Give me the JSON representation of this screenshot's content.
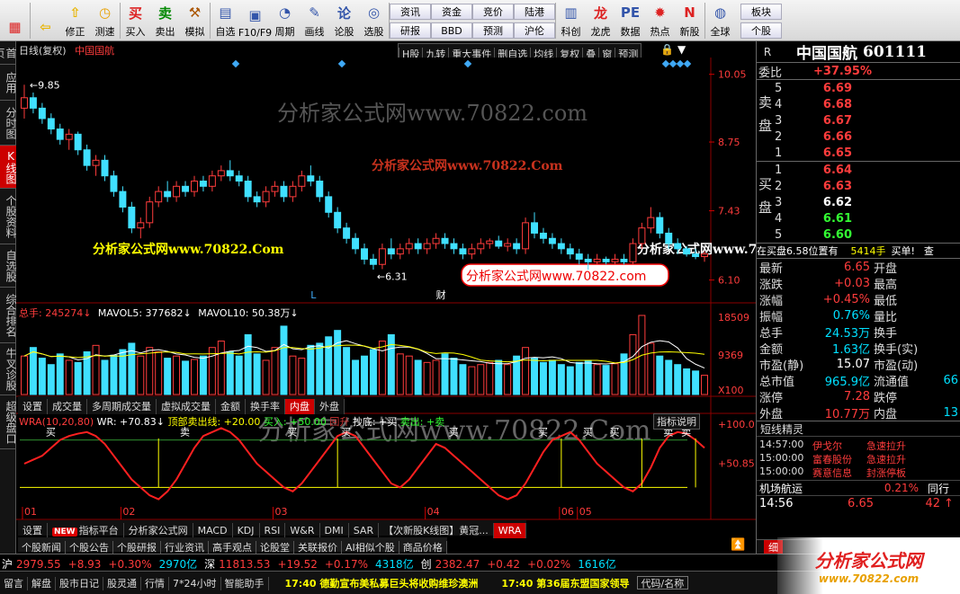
{
  "toolbar": {
    "buttons": [
      {
        "label": "",
        "icon": "windows-icon",
        "color": "#d22"
      },
      {
        "label": "",
        "icon": "back-arrow-icon",
        "color": "#e8b400"
      },
      {
        "label": "修正",
        "icon": "up-arrow-icon",
        "color": "#e8b400"
      },
      {
        "label": "测速",
        "icon": "clock-icon",
        "color": "#e8a000"
      },
      {
        "label": "买入",
        "icon": "buy-icon",
        "color": "#d22"
      },
      {
        "label": "卖出",
        "icon": "sell-icon",
        "color": "#080"
      },
      {
        "label": "模拟",
        "icon": "hammer-icon",
        "color": "#a50"
      },
      {
        "label": "自选",
        "icon": "watchlist-icon",
        "color": "#35a"
      },
      {
        "label": "F10/F9",
        "icon": "f10-icon",
        "color": "#35a"
      },
      {
        "label": "周期",
        "icon": "period-icon",
        "color": "#35a"
      },
      {
        "label": "画线",
        "icon": "pencil-icon",
        "color": "#35a"
      },
      {
        "label": "论股",
        "icon": "discuss-icon",
        "color": "#35a"
      },
      {
        "label": "选股",
        "icon": "chart-pick-icon",
        "color": "#35a"
      }
    ],
    "pairs": [
      [
        "资讯",
        "研报"
      ],
      [
        "资金",
        "BBD"
      ],
      [
        "竞价",
        "预测"
      ],
      [
        "陆港",
        "沪伦"
      ]
    ],
    "buttons2": [
      {
        "label": "科创",
        "icon": "science-icon",
        "color": "#35a"
      },
      {
        "label": "龙虎",
        "icon": "dragon-icon",
        "color": "#d22"
      },
      {
        "label": "数据",
        "icon": "pe-icon",
        "color": "#35a"
      },
      {
        "label": "热点",
        "icon": "hot-icon",
        "color": "#d22"
      },
      {
        "label": "新股",
        "icon": "new-stock-icon",
        "color": "#d22"
      },
      {
        "label": "全球",
        "icon": "globe-icon",
        "color": "#35a"
      }
    ],
    "pair_right": [
      "板块",
      "个股"
    ]
  },
  "sidebar": [
    "首页",
    "应用",
    "分时图",
    "K线图",
    "个股资料",
    "自选股",
    "综合排名",
    "牛叉诊股",
    "超级盘口"
  ],
  "chart": {
    "title_left": "日线(复权)",
    "stock_name": "中国国航",
    "buttons": [
      "H股",
      "九转",
      "重大事件",
      "删自选",
      "均线",
      "复权",
      "叠",
      "窗",
      "预测"
    ],
    "price_ticks": [
      "10.05",
      "8.75",
      "7.43",
      "6.10"
    ],
    "high_label": "9.85",
    "low_label": "6.31",
    "marker_L": "L",
    "marker_cai": "财",
    "vol_header": {
      "total": "总手: 245274↓",
      "ma5": "MAVOL5: 377682↓",
      "ma10": "MAVOL10: 50.38万↓"
    },
    "vol_ticks": [
      "18509",
      "9369",
      "X100"
    ],
    "vol_tabs": [
      "设置",
      "成交量",
      "多周期成交量",
      "虚拟成交量",
      "金额",
      "换手率",
      "内盘",
      "外盘"
    ],
    "vol_tab_active": "内盘",
    "wra_header": {
      "name": "WRA(10,20,80)",
      "wr": "WR: +70.83↓",
      "top": "顶部卖出线: +20.00",
      "mid": "买入: +50.00",
      "extra": "回升",
      "buy_sig": "抄底: +买",
      "sell_sig": "卖出: +卖"
    },
    "wra_btn": "指标说明",
    "wra_ticks": [
      "+100.0",
      "+50.85"
    ],
    "wra_signals": [
      "买",
      "卖",
      "买",
      "买",
      "买",
      "买",
      "买",
      "卖",
      "卖",
      "买"
    ],
    "months": [
      "01",
      "02",
      "03",
      "04",
      "05",
      "06"
    ],
    "ind_tabs": [
      "设置",
      "指标平台",
      "分析家公式网",
      "MACD",
      "KDJ",
      "RSI",
      "W&R",
      "DMI",
      "SAR",
      "【次新股K线图】黄冠...",
      "WRA"
    ],
    "ind_new": "NEW",
    "watermarks": [
      "分析家公式网www.70822.com",
      "分析家公式网www.70822.Com",
      "分析家公式网www.70822.Com",
      "分析家公式网www.70822.Com",
      "分析家公式网www.70822.Com",
      "分析家公式网www.70822.com"
    ]
  },
  "chart_data": [
    {
      "type": "candlestick",
      "title": "日线(复权) 中国国航",
      "y_range": [
        5.8,
        10.2
      ],
      "ohlc": [
        [
          9.4,
          9.85,
          9.2,
          9.6
        ],
        [
          9.6,
          9.7,
          9.3,
          9.4
        ],
        [
          9.4,
          9.5,
          9.1,
          9.2
        ],
        [
          9.2,
          9.3,
          8.9,
          9.0
        ],
        [
          9.0,
          9.1,
          8.7,
          8.8
        ],
        [
          8.8,
          9.0,
          8.6,
          8.9
        ],
        [
          8.9,
          8.95,
          8.5,
          8.6
        ],
        [
          8.6,
          8.7,
          8.2,
          8.3
        ],
        [
          8.3,
          8.5,
          8.1,
          8.4
        ],
        [
          8.4,
          8.5,
          8.0,
          8.1
        ],
        [
          8.1,
          8.2,
          7.7,
          7.8
        ],
        [
          7.8,
          7.9,
          7.4,
          7.5
        ],
        [
          7.5,
          7.6,
          7.0,
          7.1
        ],
        [
          7.1,
          7.3,
          6.9,
          7.2
        ],
        [
          7.2,
          7.7,
          7.1,
          7.6
        ],
        [
          7.6,
          7.9,
          7.5,
          7.8
        ],
        [
          7.8,
          8.0,
          7.6,
          7.7
        ],
        [
          7.7,
          8.0,
          7.6,
          7.9
        ],
        [
          7.9,
          8.0,
          7.7,
          7.8
        ],
        [
          7.8,
          8.1,
          7.7,
          8.0
        ],
        [
          8.0,
          8.1,
          7.8,
          7.9
        ],
        [
          7.9,
          8.2,
          7.8,
          8.1
        ],
        [
          8.1,
          8.3,
          8.0,
          8.2
        ],
        [
          8.2,
          8.4,
          8.0,
          8.1
        ],
        [
          8.1,
          8.2,
          7.9,
          8.0
        ],
        [
          8.0,
          8.1,
          7.6,
          7.7
        ],
        [
          7.7,
          7.8,
          7.5,
          7.6
        ],
        [
          7.6,
          7.9,
          7.5,
          7.8
        ],
        [
          7.8,
          8.0,
          7.7,
          7.9
        ],
        [
          7.9,
          8.0,
          7.6,
          7.7
        ],
        [
          7.7,
          8.0,
          7.6,
          7.9
        ],
        [
          7.9,
          8.2,
          7.8,
          8.1
        ],
        [
          8.1,
          8.3,
          7.9,
          8.0
        ],
        [
          8.0,
          8.1,
          7.6,
          7.7
        ],
        [
          7.7,
          7.8,
          7.3,
          7.4
        ],
        [
          7.4,
          7.5,
          7.0,
          7.1
        ],
        [
          7.1,
          7.2,
          6.8,
          6.9
        ],
        [
          6.9,
          7.0,
          6.6,
          6.7
        ],
        [
          6.7,
          6.8,
          6.4,
          6.5
        ],
        [
          6.5,
          6.6,
          6.3,
          6.4
        ],
        [
          6.4,
          6.8,
          6.31,
          6.7
        ],
        [
          6.7,
          6.9,
          6.5,
          6.6
        ],
        [
          6.6,
          6.8,
          6.5,
          6.7
        ],
        [
          6.7,
          6.9,
          6.6,
          6.8
        ],
        [
          6.8,
          6.9,
          6.6,
          6.7
        ],
        [
          6.7,
          6.9,
          6.6,
          6.8
        ],
        [
          6.8,
          7.0,
          6.7,
          6.9
        ],
        [
          6.9,
          7.0,
          6.7,
          6.8
        ],
        [
          6.8,
          6.9,
          6.6,
          6.7
        ],
        [
          6.7,
          6.8,
          6.5,
          6.6
        ],
        [
          6.6,
          6.8,
          6.5,
          6.7
        ],
        [
          6.7,
          6.9,
          6.6,
          6.8
        ],
        [
          6.8,
          6.9,
          6.7,
          6.85
        ],
        [
          6.85,
          6.95,
          6.7,
          6.75
        ],
        [
          6.75,
          6.9,
          6.65,
          6.8
        ],
        [
          6.8,
          6.9,
          6.6,
          6.7
        ],
        [
          6.7,
          7.3,
          6.6,
          7.2
        ],
        [
          7.2,
          7.4,
          6.9,
          7.0
        ],
        [
          7.0,
          7.1,
          6.8,
          6.9
        ],
        [
          6.9,
          7.0,
          6.7,
          6.8
        ],
        [
          6.8,
          6.9,
          6.6,
          6.7
        ],
        [
          6.7,
          6.8,
          6.5,
          6.6
        ],
        [
          6.6,
          6.7,
          6.4,
          6.5
        ],
        [
          6.5,
          6.6,
          6.3,
          6.45
        ],
        [
          6.45,
          6.6,
          6.4,
          6.5
        ],
        [
          6.5,
          6.55,
          6.4,
          6.45
        ],
        [
          6.45,
          6.6,
          6.4,
          6.5
        ],
        [
          6.5,
          6.6,
          6.4,
          6.45
        ],
        [
          6.45,
          6.9,
          6.4,
          6.8
        ],
        [
          6.8,
          7.2,
          6.7,
          7.1
        ],
        [
          7.1,
          7.5,
          7.0,
          7.3
        ],
        [
          7.3,
          7.4,
          6.9,
          7.0
        ],
        [
          7.0,
          7.1,
          6.7,
          6.8
        ],
        [
          6.8,
          6.9,
          6.6,
          6.7
        ],
        [
          6.7,
          6.75,
          6.55,
          6.6
        ],
        [
          6.6,
          6.7,
          6.5,
          6.55
        ],
        [
          6.55,
          6.65,
          6.45,
          6.6
        ]
      ]
    },
    {
      "type": "bar",
      "title": "成交量",
      "y_range": [
        0,
        18509
      ],
      "values": [
        9000,
        11000,
        8500,
        7000,
        9500,
        8000,
        7500,
        10000,
        11500,
        8000,
        9200,
        10500,
        12000,
        9000,
        11000,
        10000,
        8500,
        9000,
        7800,
        8200,
        9000,
        11000,
        12500,
        10000,
        9000,
        14000,
        9500,
        8000,
        11000,
        16000,
        9000,
        8500,
        11500,
        12000,
        13500,
        15000,
        11000,
        8000,
        9000,
        10500,
        12500,
        14000,
        9500,
        9000,
        8000,
        7500,
        8000,
        9500,
        8500,
        7000,
        6500,
        7000,
        7500,
        8000,
        7000,
        9000,
        11000,
        8500,
        7500,
        8000,
        7000,
        6500,
        7500,
        8000,
        7000,
        6800,
        7200,
        9500,
        14000,
        18509,
        12000,
        9000,
        8000,
        7000,
        6000,
        5500,
        4500
      ]
    },
    {
      "type": "line",
      "title": "WRA(10,20,80)",
      "y_range": [
        0,
        100
      ],
      "values": [
        50,
        55,
        60,
        70,
        80,
        85,
        88,
        90,
        85,
        75,
        60,
        45,
        30,
        20,
        10,
        5,
        15,
        30,
        50,
        70,
        85,
        90,
        95,
        90,
        80,
        65,
        50,
        40,
        30,
        20,
        15,
        25,
        40,
        55,
        70,
        85,
        90,
        85,
        70,
        55,
        40,
        25,
        20,
        30,
        45,
        60,
        75,
        70,
        60,
        50,
        40,
        30,
        20,
        10,
        5,
        10,
        25,
        45,
        65,
        80,
        85,
        90,
        80,
        65,
        50,
        40,
        30,
        20,
        15,
        25,
        45,
        70,
        85,
        90,
        88,
        80,
        70
      ]
    }
  ],
  "quote": {
    "market": "R",
    "name": "中国国航",
    "code": "601111",
    "ratio_label": "委比",
    "ratio": "+37.95%",
    "sell_label": [
      "卖",
      "盘"
    ],
    "buy_label": [
      "买",
      "盘"
    ],
    "sells": [
      [
        "5",
        "6.69"
      ],
      [
        "4",
        "6.68"
      ],
      [
        "3",
        "6.67"
      ],
      [
        "2",
        "6.66"
      ],
      [
        "1",
        "6.65"
      ]
    ],
    "buys": [
      [
        "1",
        "6.64"
      ],
      [
        "2",
        "6.63"
      ],
      [
        "3",
        "6.62"
      ],
      [
        "4",
        "6.61"
      ],
      [
        "5",
        "6.60"
      ]
    ],
    "sell_vols": [
      "",
      "",
      "",
      "",
      ""
    ],
    "pos_text": "在买盘6.58位置有",
    "pos_vol": "5414手",
    "pos_act": "买单!",
    "pos_more": "查",
    "stats": [
      [
        "最新",
        "6.65",
        "red",
        "开盘",
        ""
      ],
      [
        "涨跌",
        "+0.03",
        "red",
        "最高",
        ""
      ],
      [
        "涨幅",
        "+0.45%",
        "red",
        "最低",
        ""
      ],
      [
        "振幅",
        "0.76%",
        "cyan",
        "量比",
        ""
      ],
      [
        "总手",
        "24.53万",
        "cyan",
        "换手",
        ""
      ],
      [
        "金额",
        "1.63亿",
        "cyan",
        "换手(实)",
        ""
      ],
      [
        "市盈(静)",
        "15.07",
        "white",
        "市盈(动)",
        ""
      ],
      [
        "总市值",
        "965.9亿",
        "cyan",
        "流通值",
        "66"
      ],
      [
        "涨停",
        "7.28",
        "red",
        "跌停",
        ""
      ],
      [
        "外盘",
        "10.77万",
        "red",
        "内盘",
        "13"
      ]
    ],
    "short_title": "短线精灵",
    "short": [
      [
        "14:57:00",
        "伊戈尔",
        "急速拉升"
      ],
      [
        "15:00:00",
        "富春股份",
        "急速拉升"
      ],
      [
        "15:00:00",
        "赛意信息",
        "封涨停板"
      ]
    ],
    "sector": {
      "name": "机场航运",
      "pct": "0.21%",
      "more": "同行"
    },
    "last": {
      "time": "14:56",
      "price": "6.65",
      "vol": "42"
    },
    "detail_tab": "细"
  },
  "newsbar": [
    "个股新闻",
    "个股公告",
    "个股研报",
    "行业资讯",
    "高手观点",
    "论股堂",
    "关联报价",
    "AI相似个股",
    "商品价格"
  ],
  "status": {
    "sh": [
      "沪",
      "2979.55",
      "+8.93",
      "+0.30%",
      "2970亿"
    ],
    "sz": [
      "深",
      "11813.53",
      "+19.52",
      "+0.17%",
      "4318亿"
    ],
    "cy": [
      "创",
      "2382.47",
      "+0.42",
      "+0.02%",
      "1616亿"
    ]
  },
  "bottom": {
    "items": [
      "留言",
      "解盘",
      "股市日记",
      "股灵通",
      "行情",
      "7*24小时",
      "智能助手"
    ],
    "ticker1": "17:40 德勤宣布美私募巨头将收购维珍澳洲",
    "ticker2": "17:40 第36届东盟国家领导",
    "code_btn": "代码/名称",
    "brand": "分析家公式网",
    "brand_url": "www.70822.com"
  }
}
